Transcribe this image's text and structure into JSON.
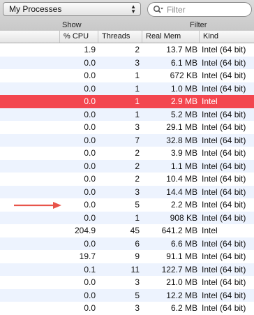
{
  "toolbar": {
    "process_filter": "My Processes",
    "search_placeholder": "Filter",
    "show_label": "Show",
    "filter_label": "Filter"
  },
  "columns": {
    "cpu": "% CPU",
    "threads": "Threads",
    "real_mem": "Real Mem",
    "kind": "Kind"
  },
  "rows": [
    {
      "cpu": "1.9",
      "threads": "2",
      "mem": "13.7 MB",
      "kind": "Intel (64 bit)"
    },
    {
      "cpu": "0.0",
      "threads": "3",
      "mem": "6.1 MB",
      "kind": "Intel (64 bit)"
    },
    {
      "cpu": "0.0",
      "threads": "1",
      "mem": "672 KB",
      "kind": "Intel (64 bit)"
    },
    {
      "cpu": "0.0",
      "threads": "1",
      "mem": "1.0 MB",
      "kind": "Intel (64 bit)"
    },
    {
      "cpu": "0.0",
      "threads": "1",
      "mem": "2.9 MB",
      "kind": "Intel"
    },
    {
      "cpu": "0.0",
      "threads": "1",
      "mem": "5.2 MB",
      "kind": "Intel (64 bit)"
    },
    {
      "cpu": "0.0",
      "threads": "3",
      "mem": "29.1 MB",
      "kind": "Intel (64 bit)"
    },
    {
      "cpu": "0.0",
      "threads": "7",
      "mem": "32.8 MB",
      "kind": "Intel (64 bit)"
    },
    {
      "cpu": "0.0",
      "threads": "2",
      "mem": "3.9 MB",
      "kind": "Intel (64 bit)"
    },
    {
      "cpu": "0.0",
      "threads": "2",
      "mem": "1.1 MB",
      "kind": "Intel (64 bit)"
    },
    {
      "cpu": "0.0",
      "threads": "2",
      "mem": "10.4 MB",
      "kind": "Intel (64 bit)"
    },
    {
      "cpu": "0.0",
      "threads": "3",
      "mem": "14.4 MB",
      "kind": "Intel (64 bit)"
    },
    {
      "cpu": "0.0",
      "threads": "5",
      "mem": "2.2 MB",
      "kind": "Intel (64 bit)"
    },
    {
      "cpu": "0.0",
      "threads": "1",
      "mem": "908 KB",
      "kind": "Intel (64 bit)"
    },
    {
      "cpu": "204.9",
      "threads": "45",
      "mem": "641.2 MB",
      "kind": "Intel"
    },
    {
      "cpu": "0.0",
      "threads": "6",
      "mem": "6.6 MB",
      "kind": "Intel (64 bit)"
    },
    {
      "cpu": "19.7",
      "threads": "9",
      "mem": "91.1 MB",
      "kind": "Intel (64 bit)"
    },
    {
      "cpu": "0.1",
      "threads": "11",
      "mem": "122.7 MB",
      "kind": "Intel (64 bit)"
    },
    {
      "cpu": "0.0",
      "threads": "3",
      "mem": "21.0 MB",
      "kind": "Intel (64 bit)"
    },
    {
      "cpu": "0.0",
      "threads": "5",
      "mem": "12.2 MB",
      "kind": "Intel (64 bit)"
    },
    {
      "cpu": "0.0",
      "threads": "3",
      "mem": "6.2 MB",
      "kind": "Intel (64 bit)"
    }
  ],
  "selected_row": 4,
  "colors": {
    "selected_row": "#f3464f",
    "stripe": "#edf3fe",
    "annotation_arrow": "#e8544a"
  },
  "icons": {
    "search": "magnifier-with-dropdown-icon",
    "popup": "up-down-chevron-icon",
    "annotation": "red-arrow-icon"
  }
}
